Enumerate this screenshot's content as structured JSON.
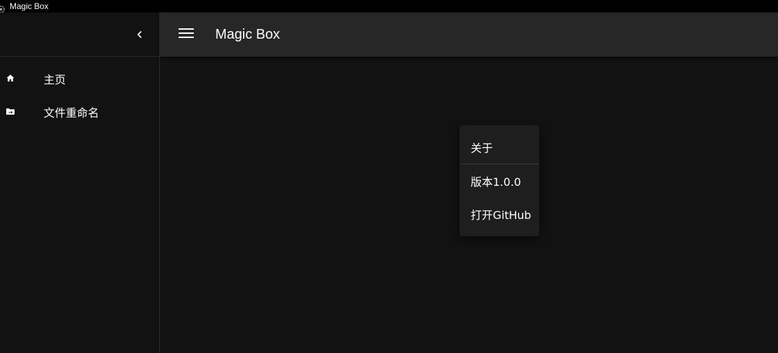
{
  "window": {
    "title": "Magic Box",
    "icon": "app-gear-icon"
  },
  "drawer": {
    "collapse_icon": "chevron-left-icon",
    "items": [
      {
        "label": "主页",
        "icon": "home-icon"
      },
      {
        "label": "文件重命名",
        "icon": "folder-move-icon"
      }
    ]
  },
  "appbar": {
    "menu_icon": "hamburger-menu-icon",
    "title": "Magic Box"
  },
  "about_menu": {
    "header": "关于",
    "version": "版本1.0.0",
    "github": "打开GitHub"
  },
  "colors": {
    "background": "#121212",
    "appbar": "#272727",
    "menu": "#1e1e1e",
    "titlebar": "#000000",
    "text": "#ffffff"
  }
}
